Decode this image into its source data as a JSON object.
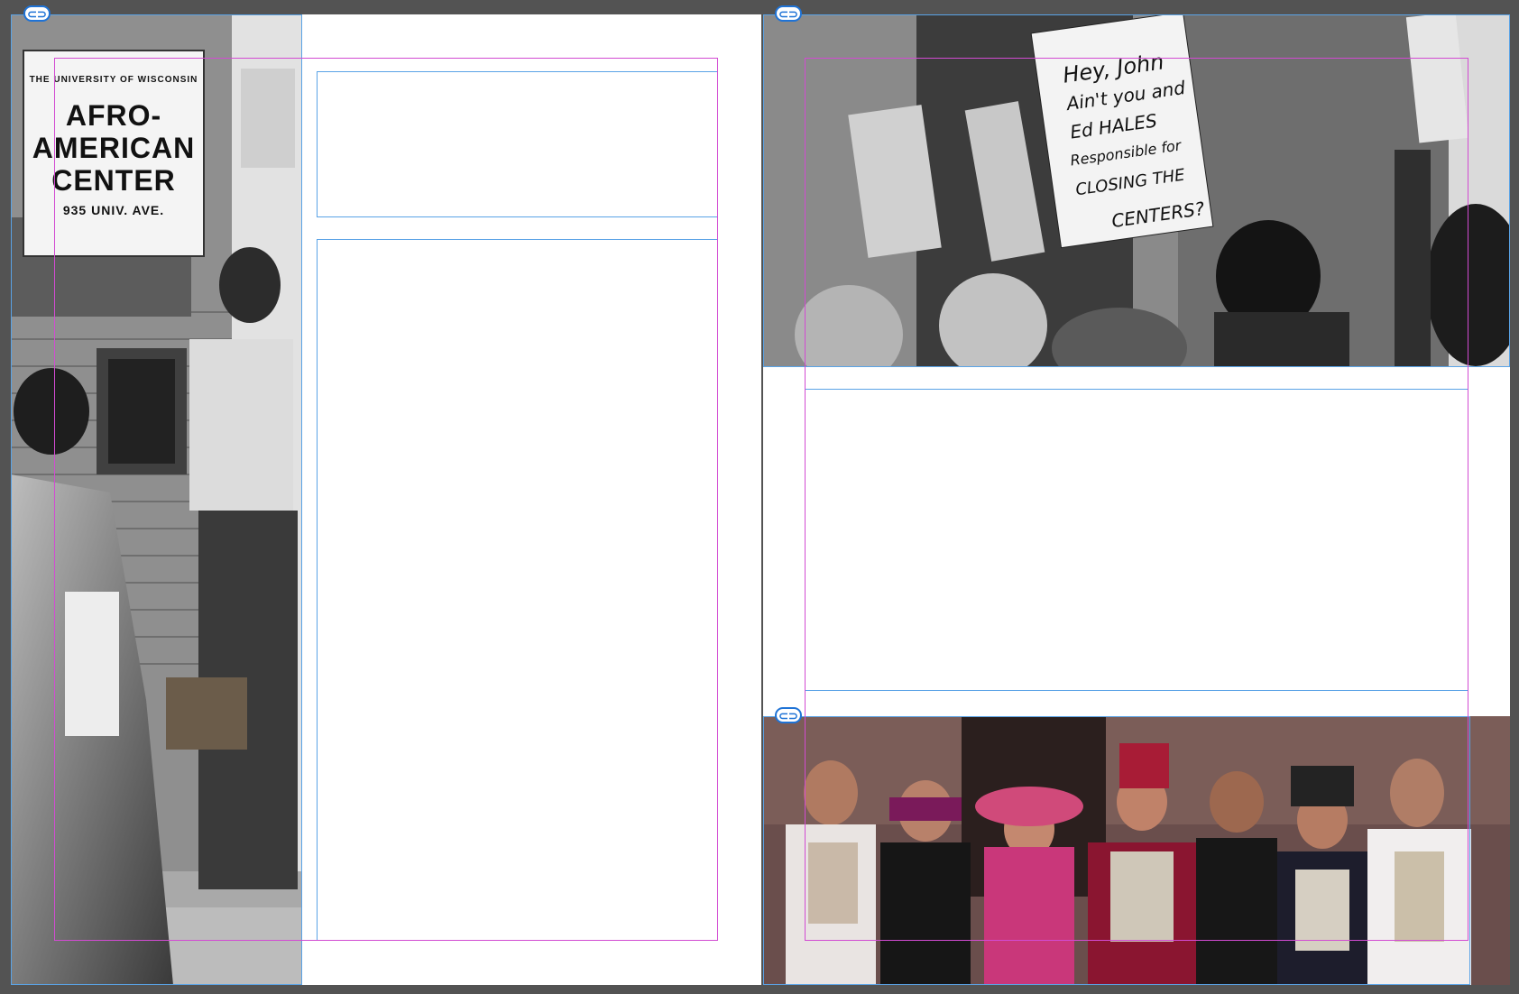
{
  "spread": {
    "left_page": {
      "photo": {
        "sign_line1": "THE UNIVERSITY OF WISCONSIN",
        "sign_line2": "AFRO-",
        "sign_line3": "AMERICAN",
        "sign_line4": "CENTER",
        "sign_line5": "935 UNIV. AVE."
      }
    },
    "right_page": {
      "protest_photo": {
        "placard_lines": [
          "Hey, John",
          "Ain't you and",
          "Ed HALES",
          "Responsible for",
          "CLOSING THE",
          "CENTERS?"
        ]
      },
      "hmong_photo": {}
    }
  },
  "icons": {
    "link_icon_glyph": "⊂⊃"
  },
  "colors": {
    "pasteboard": "#535353",
    "page": "#ffffff",
    "margin_guide": "#d24bd2",
    "frame_edge": "#5aa3e6",
    "link_badge": "#1f73d6"
  }
}
